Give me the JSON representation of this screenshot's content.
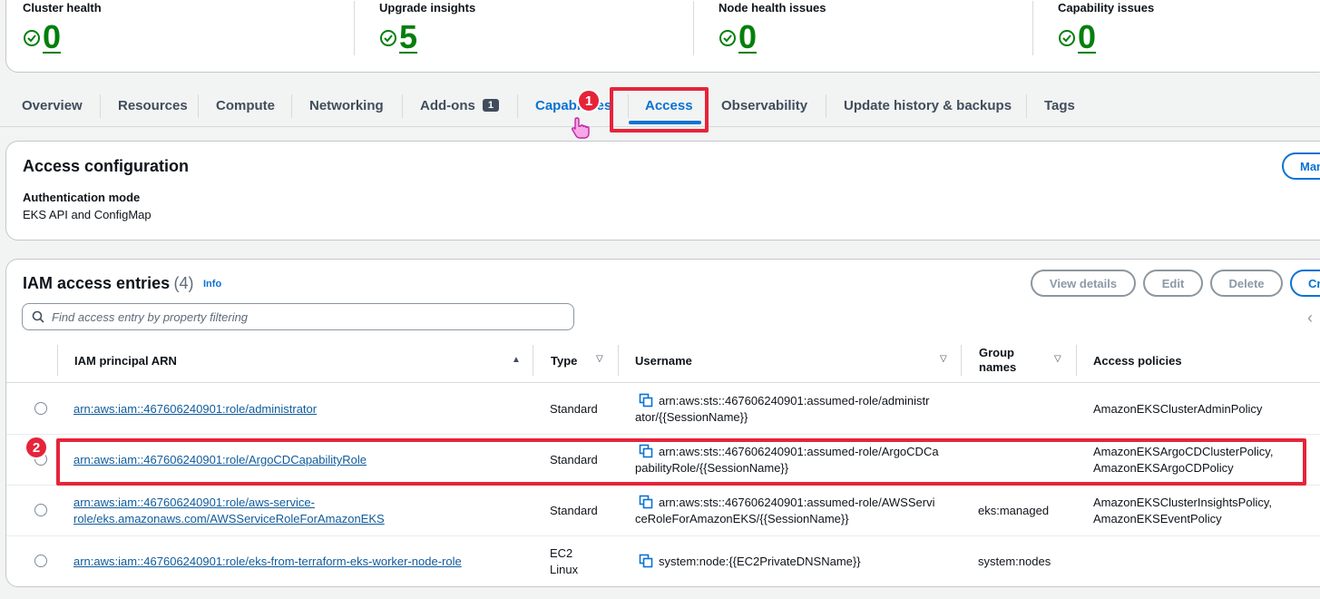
{
  "summary": {
    "metrics": [
      {
        "label": "Cluster health",
        "value": "0"
      },
      {
        "label": "Upgrade insights",
        "value": "5"
      },
      {
        "label": "Node health issues",
        "value": "0"
      },
      {
        "label": "Capability issues",
        "value": "0"
      }
    ]
  },
  "tabs": {
    "overview": "Overview",
    "resources": "Resources",
    "compute": "Compute",
    "networking": "Networking",
    "addons": "Add-ons",
    "addons_badge": "1",
    "capabilities": "Capabilities",
    "access": "Access",
    "observability": "Observability",
    "update_history": "Update history & backups",
    "tags": "Tags"
  },
  "access_config": {
    "title": "Access configuration",
    "manage_button": "Manage",
    "auth_mode_label": "Authentication mode",
    "auth_mode_value": "EKS API and ConfigMap"
  },
  "iam_entries": {
    "title": "IAM access entries",
    "count": "(4)",
    "info": "Info",
    "buttons": {
      "view_details": "View details",
      "edit": "Edit",
      "delete": "Delete",
      "create": "Create"
    },
    "search_placeholder": "Find access entry by property filtering",
    "columns": {
      "arn": "IAM principal ARN",
      "type": "Type",
      "username": "Username",
      "group_line1": "Group",
      "group_line2": "names",
      "policies": "Access policies"
    },
    "rows": [
      {
        "arn_line1": "arn:aws:iam::467606240901:role/administrator",
        "arn_line2": "",
        "type_line1": "Standard",
        "type_line2": "",
        "user_line1": "arn:aws:sts::467606240901:assumed-role/administr",
        "user_line2": "ator/{{SessionName}}",
        "group": "",
        "policy_line1": "AmazonEKSClusterAdminPolicy",
        "policy_line2": ""
      },
      {
        "arn_line1": "arn:aws:iam::467606240901:role/ArgoCDCapabilityRole",
        "arn_line2": "",
        "type_line1": "Standard",
        "type_line2": "",
        "user_line1": "arn:aws:sts::467606240901:assumed-role/ArgoCDCa",
        "user_line2": "pabilityRole/{{SessionName}}",
        "group": "",
        "policy_line1": "AmazonEKSArgoCDClusterPolicy,",
        "policy_line2": "AmazonEKSArgoCDPolicy"
      },
      {
        "arn_line1": "arn:aws:iam::467606240901:role/aws-service-",
        "arn_line2": "role/eks.amazonaws.com/AWSServiceRoleForAmazonEKS",
        "type_line1": "Standard",
        "type_line2": "",
        "user_line1": "arn:aws:sts::467606240901:assumed-role/AWSServi",
        "user_line2": "ceRoleForAmazonEKS/{{SessionName}}",
        "group": "eks:managed",
        "policy_line1": "AmazonEKSClusterInsightsPolicy,",
        "policy_line2": "AmazonEKSEventPolicy"
      },
      {
        "arn_line1": "arn:aws:iam::467606240901:role/eks-from-terraform-eks-worker-node-role",
        "arn_line2": "",
        "type_line1": "EC2",
        "type_line2": "Linux",
        "user_line1": "system:node:{{EC2PrivateDNSName}}",
        "user_line2": "",
        "group": "system:nodes",
        "policy_line1": "",
        "policy_line2": ""
      }
    ]
  },
  "annotations": {
    "step1": "1",
    "step2": "2"
  },
  "colors": {
    "success": "#037f0c",
    "link": "#0972d3",
    "highlight": "#e5243a"
  }
}
